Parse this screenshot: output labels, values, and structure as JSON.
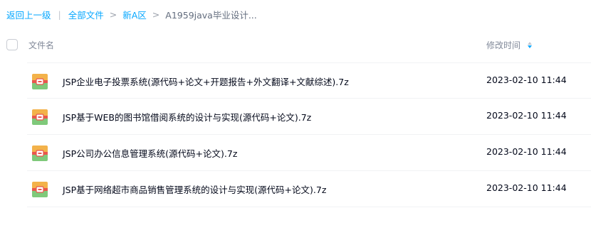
{
  "breadcrumb": {
    "back_label": "返回上一级",
    "separator_bar": "|",
    "separator_gt": ">",
    "items": [
      "全部文件",
      "新A区"
    ],
    "current": "A1959java毕业设计..."
  },
  "table": {
    "col_name": "文件名",
    "col_time": "修改时间",
    "sort_direction": "descending",
    "rows": [
      {
        "icon": "archive-icon",
        "name": "JSP企业电子投票系统(源代码+论文+开题报告+外文翻译+文献综述).7z",
        "time": "2023-02-10 11:44"
      },
      {
        "icon": "archive-icon",
        "name": "JSP基于WEB的图书馆借阅系统的设计与实现(源代码+论文).7z",
        "time": "2023-02-10 11:44"
      },
      {
        "icon": "archive-icon",
        "name": "JSP公司办公信息管理系统(源代码+论文).7z",
        "time": "2023-02-10 11:44"
      },
      {
        "icon": "archive-icon",
        "name": "JSP基于网络超市商品销售管理系统的设计与实现(源代码+论文).7z",
        "time": "2023-02-10 11:44"
      }
    ]
  },
  "colors": {
    "link": "#06a7ff",
    "text": "#03081a",
    "muted": "#818999"
  }
}
